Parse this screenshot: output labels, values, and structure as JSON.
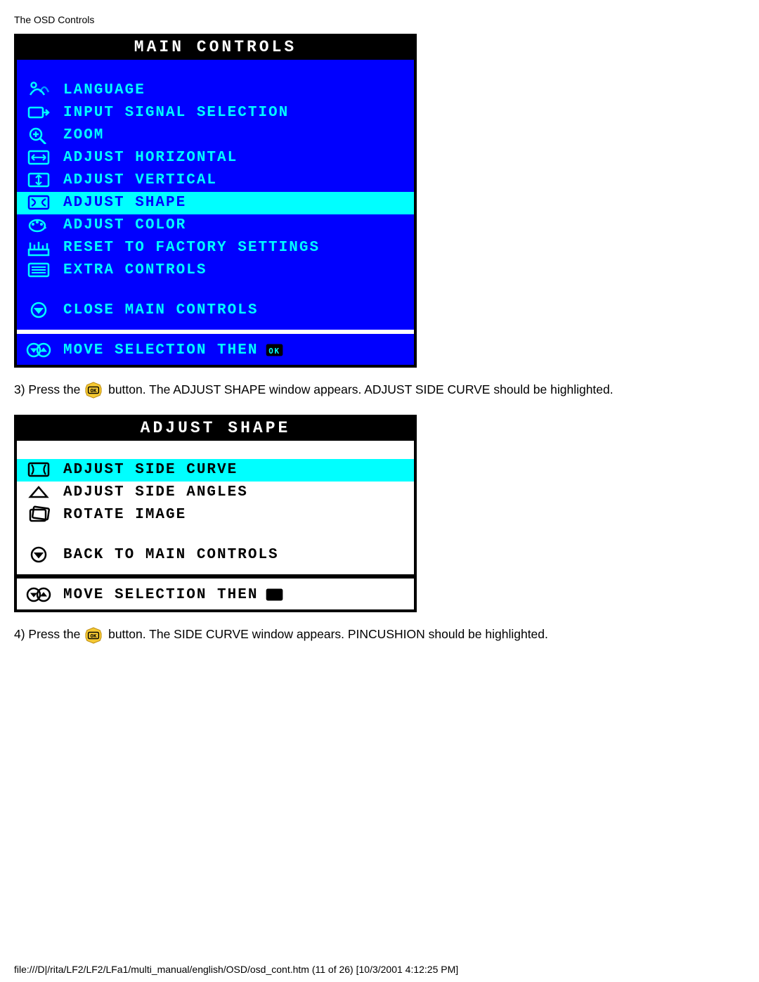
{
  "page_header": "The OSD Controls",
  "osd_main": {
    "title": "MAIN CONTROLS",
    "items": [
      {
        "icon": "language",
        "label": "LANGUAGE",
        "highlighted": false
      },
      {
        "icon": "input",
        "label": "INPUT SIGNAL SELECTION",
        "highlighted": false
      },
      {
        "icon": "zoom",
        "label": "ZOOM",
        "highlighted": false
      },
      {
        "icon": "adj-horiz",
        "label": "ADJUST HORIZONTAL",
        "highlighted": false
      },
      {
        "icon": "adj-vert",
        "label": "ADJUST VERTICAL",
        "highlighted": false
      },
      {
        "icon": "shape",
        "label": "ADJUST SHAPE",
        "highlighted": true
      },
      {
        "icon": "color",
        "label": "ADJUST COLOR",
        "highlighted": false
      },
      {
        "icon": "reset",
        "label": "RESET TO FACTORY SETTINGS",
        "highlighted": false
      },
      {
        "icon": "extra",
        "label": "EXTRA CONTROLS",
        "highlighted": false
      }
    ],
    "close_icon": "down-circle",
    "close_label": "CLOSE MAIN CONTROLS",
    "footer_icon": "updown-circle",
    "footer_text": "MOVE SELECTION THEN",
    "footer_ok": "ok-box"
  },
  "instruction3_a": "3) Press the ",
  "instruction3_b": " button. The ADJUST SHAPE window appears. ADJUST SIDE CURVE should be highlighted.",
  "osd_shape": {
    "title": "ADJUST SHAPE",
    "items": [
      {
        "icon": "side-curve",
        "label": "ADJUST SIDE CURVE",
        "highlighted": true
      },
      {
        "icon": "side-angles",
        "label": "ADJUST SIDE ANGLES",
        "highlighted": false
      },
      {
        "icon": "rotate",
        "label": "ROTATE IMAGE",
        "highlighted": false
      }
    ],
    "back_icon": "down-circle",
    "back_label": "BACK TO MAIN CONTROLS",
    "footer_icon": "updown-circle",
    "footer_text": "MOVE SELECTION THEN",
    "footer_ok": "ok-box"
  },
  "instruction4_a": "4) Press the ",
  "instruction4_b": " button. The SIDE CURVE window appears. PINCUSHION should be highlighted.",
  "page_footer": "file:///D|/rita/LF2/LF2/LFa1/multi_manual/english/OSD/osd_cont.htm (11 of 26) [10/3/2001 4:12:25 PM]"
}
